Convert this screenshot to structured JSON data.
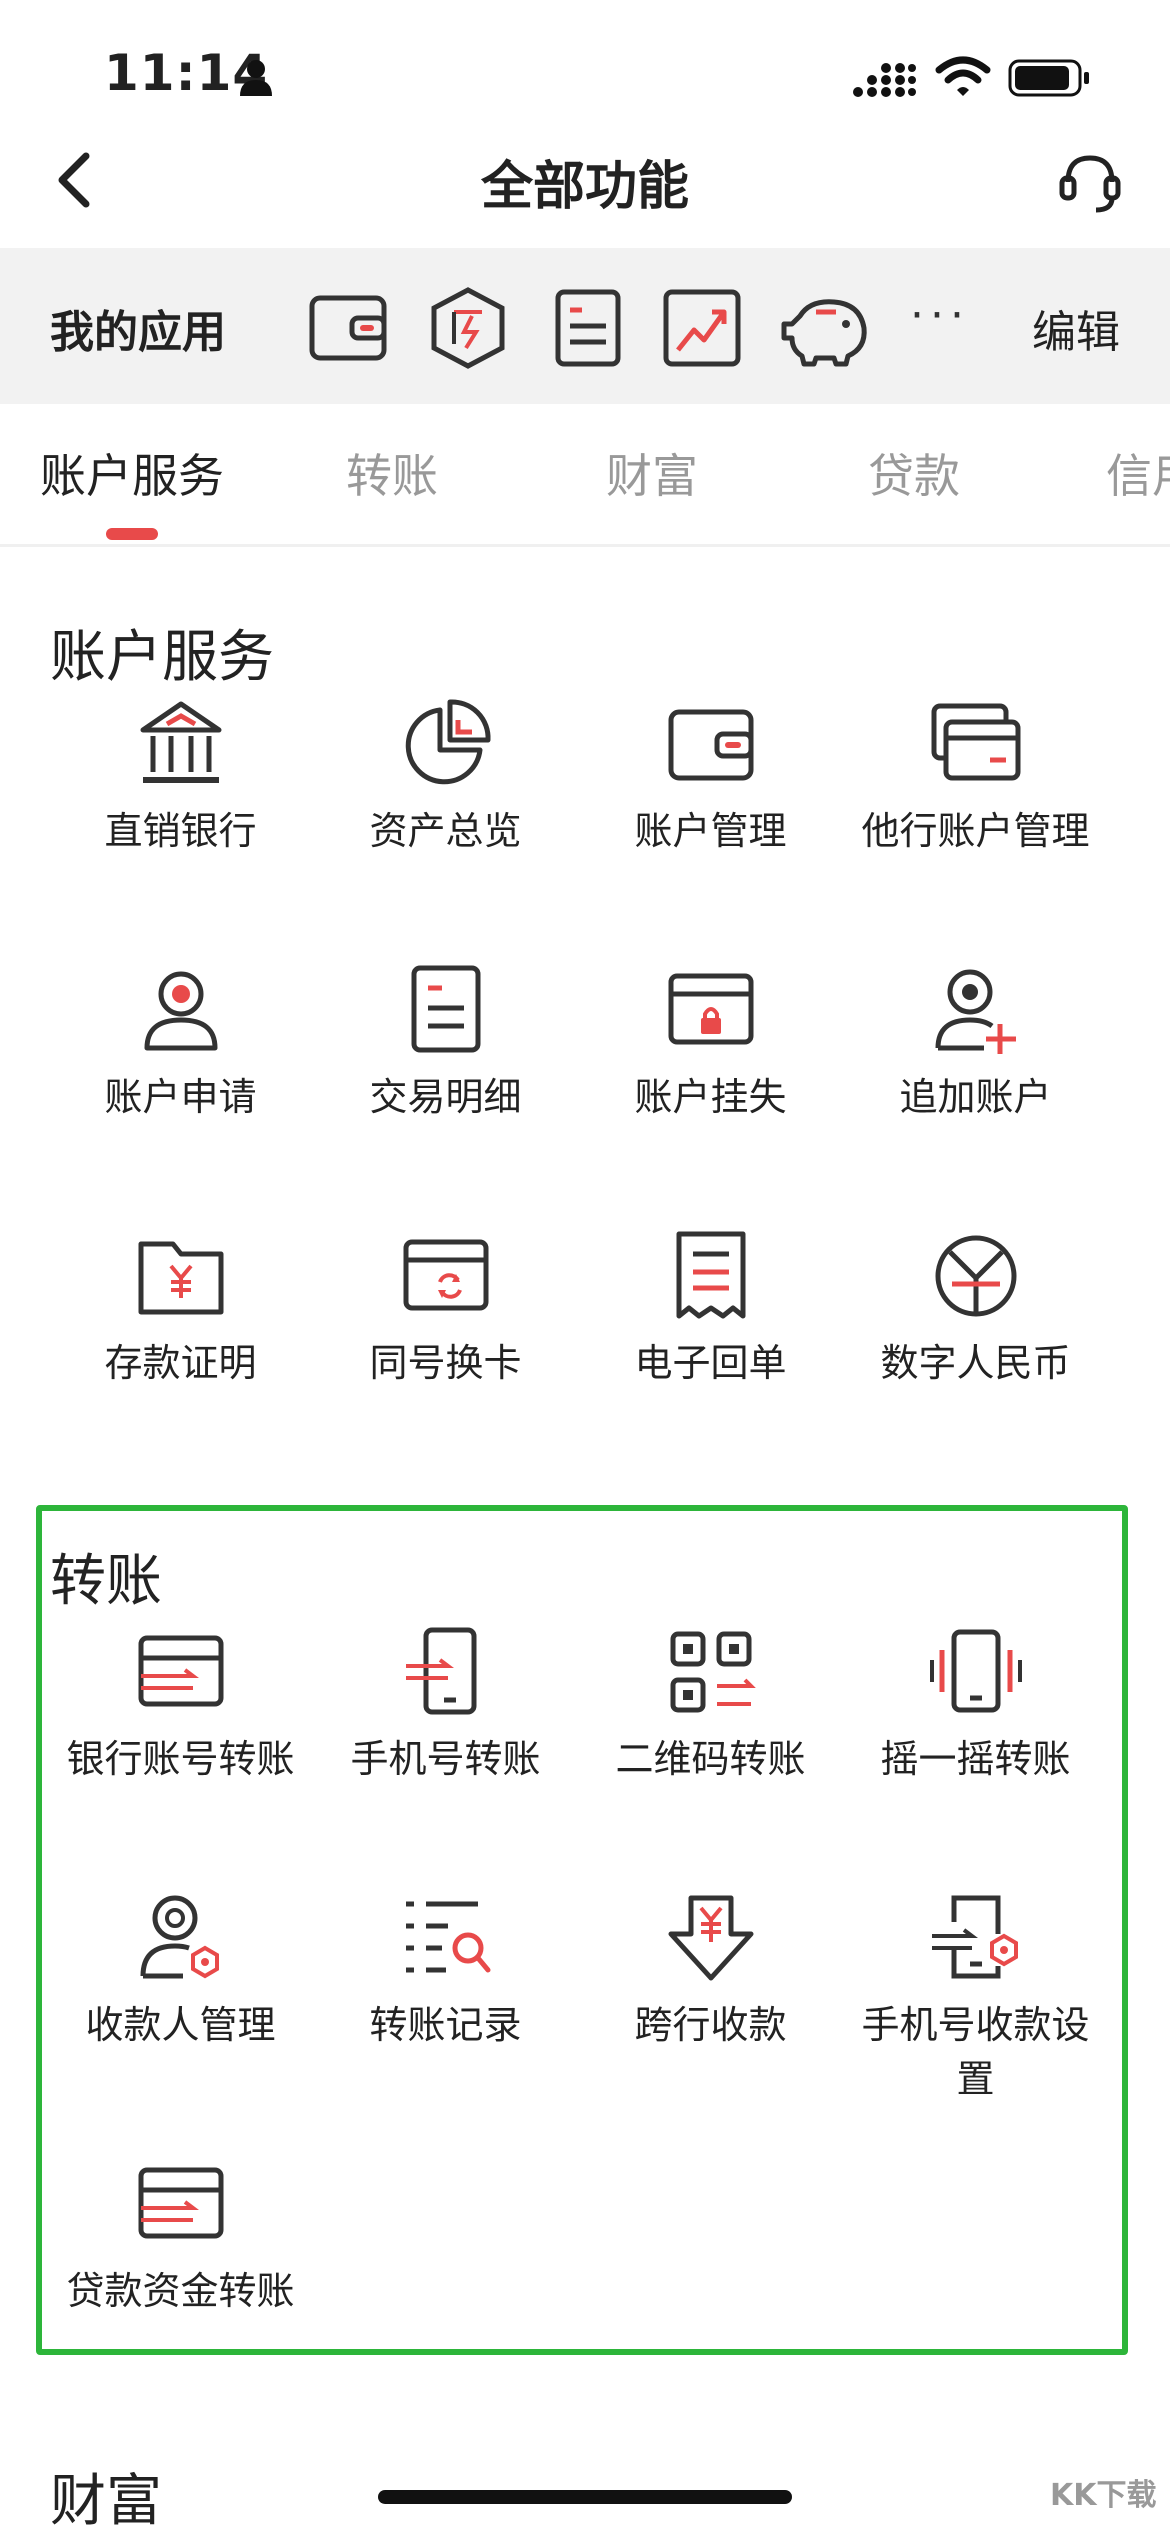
{
  "status_bar": {
    "time": "11:14"
  },
  "nav": {
    "title": "全部功能"
  },
  "my_apps": {
    "label": "我的应用",
    "more": "···",
    "edit": "编辑"
  },
  "tabs": [
    {
      "label": "账户服务"
    },
    {
      "label": "转账"
    },
    {
      "label": "财富"
    },
    {
      "label": "贷款"
    },
    {
      "label": "信用"
    }
  ],
  "sections": {
    "account": {
      "title": "账户服务",
      "items": [
        {
          "label": "直销银行",
          "icon": "bank-icon"
        },
        {
          "label": "资产总览",
          "icon": "pie-chart-icon"
        },
        {
          "label": "账户管理",
          "icon": "wallet-icon"
        },
        {
          "label": "他行账户管理",
          "icon": "cards-icon"
        },
        {
          "label": "账户申请",
          "icon": "user-icon"
        },
        {
          "label": "交易明细",
          "icon": "document-icon"
        },
        {
          "label": "账户挂失",
          "icon": "card-lock-icon"
        },
        {
          "label": "追加账户",
          "icon": "add-user-icon"
        },
        {
          "label": "存款证明",
          "icon": "folder-yuan-icon"
        },
        {
          "label": "同号换卡",
          "icon": "card-refresh-icon"
        },
        {
          "label": "电子回单",
          "icon": "receipt-icon"
        },
        {
          "label": "数字人民币",
          "icon": "digital-rmb-icon"
        }
      ]
    },
    "transfer": {
      "title": "转账",
      "items": [
        {
          "label": "银行账号转账",
          "icon": "card-transfer-icon"
        },
        {
          "label": "手机号转账",
          "icon": "phone-transfer-icon"
        },
        {
          "label": "二维码转账",
          "icon": "qr-transfer-icon"
        },
        {
          "label": "摇一摇转账",
          "icon": "shake-phone-icon"
        },
        {
          "label": "收款人管理",
          "icon": "payee-settings-icon"
        },
        {
          "label": "转账记录",
          "icon": "list-search-icon"
        },
        {
          "label": "跨行收款",
          "icon": "yuan-arrow-down-icon"
        },
        {
          "label": "手机号收款设置",
          "icon": "phone-settings-icon"
        },
        {
          "label": "贷款资金转账",
          "icon": "card-transfer-icon"
        }
      ]
    },
    "wealth": {
      "title": "财富"
    }
  },
  "watermark": "KK下载",
  "colors": {
    "accent": "#e84a4a",
    "highlight": "#2db53a",
    "icon_dark": "#333333"
  }
}
